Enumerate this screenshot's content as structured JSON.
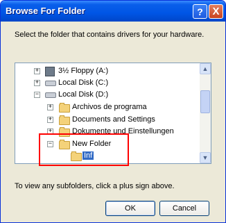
{
  "window": {
    "title": "Browse For Folder",
    "help_symbol": "?",
    "close_symbol": "X"
  },
  "instruction": "Select the folder that contains drivers for your hardware.",
  "tree": {
    "items": [
      {
        "label": "3½ Floppy (A:)",
        "expander": "+",
        "icon": "floppy-drive-icon"
      },
      {
        "label": "Local Disk (C:)",
        "expander": "+",
        "icon": "hard-drive-icon"
      },
      {
        "label": "Local Disk (D:)",
        "expander": "−",
        "icon": "hard-drive-icon"
      },
      {
        "label": "Archivos de programa",
        "expander": "+",
        "icon": "folder-icon"
      },
      {
        "label": "Documents and Settings",
        "expander": "+",
        "icon": "folder-icon"
      },
      {
        "label": "Dokumente und Einstellungen",
        "expander": "+",
        "icon": "folder-icon"
      },
      {
        "label": "New Folder",
        "expander": "−",
        "icon": "folder-icon"
      },
      {
        "label": "Inf",
        "expander": "",
        "icon": "folder-open-icon",
        "selected": true
      }
    ]
  },
  "hint": "To view any subfolders, click a plus sign above.",
  "buttons": {
    "ok": "OK",
    "cancel": "Cancel"
  },
  "colors": {
    "titlebar": "#0055E5",
    "selection": "#316AC5",
    "annotation": "#FF0000"
  }
}
